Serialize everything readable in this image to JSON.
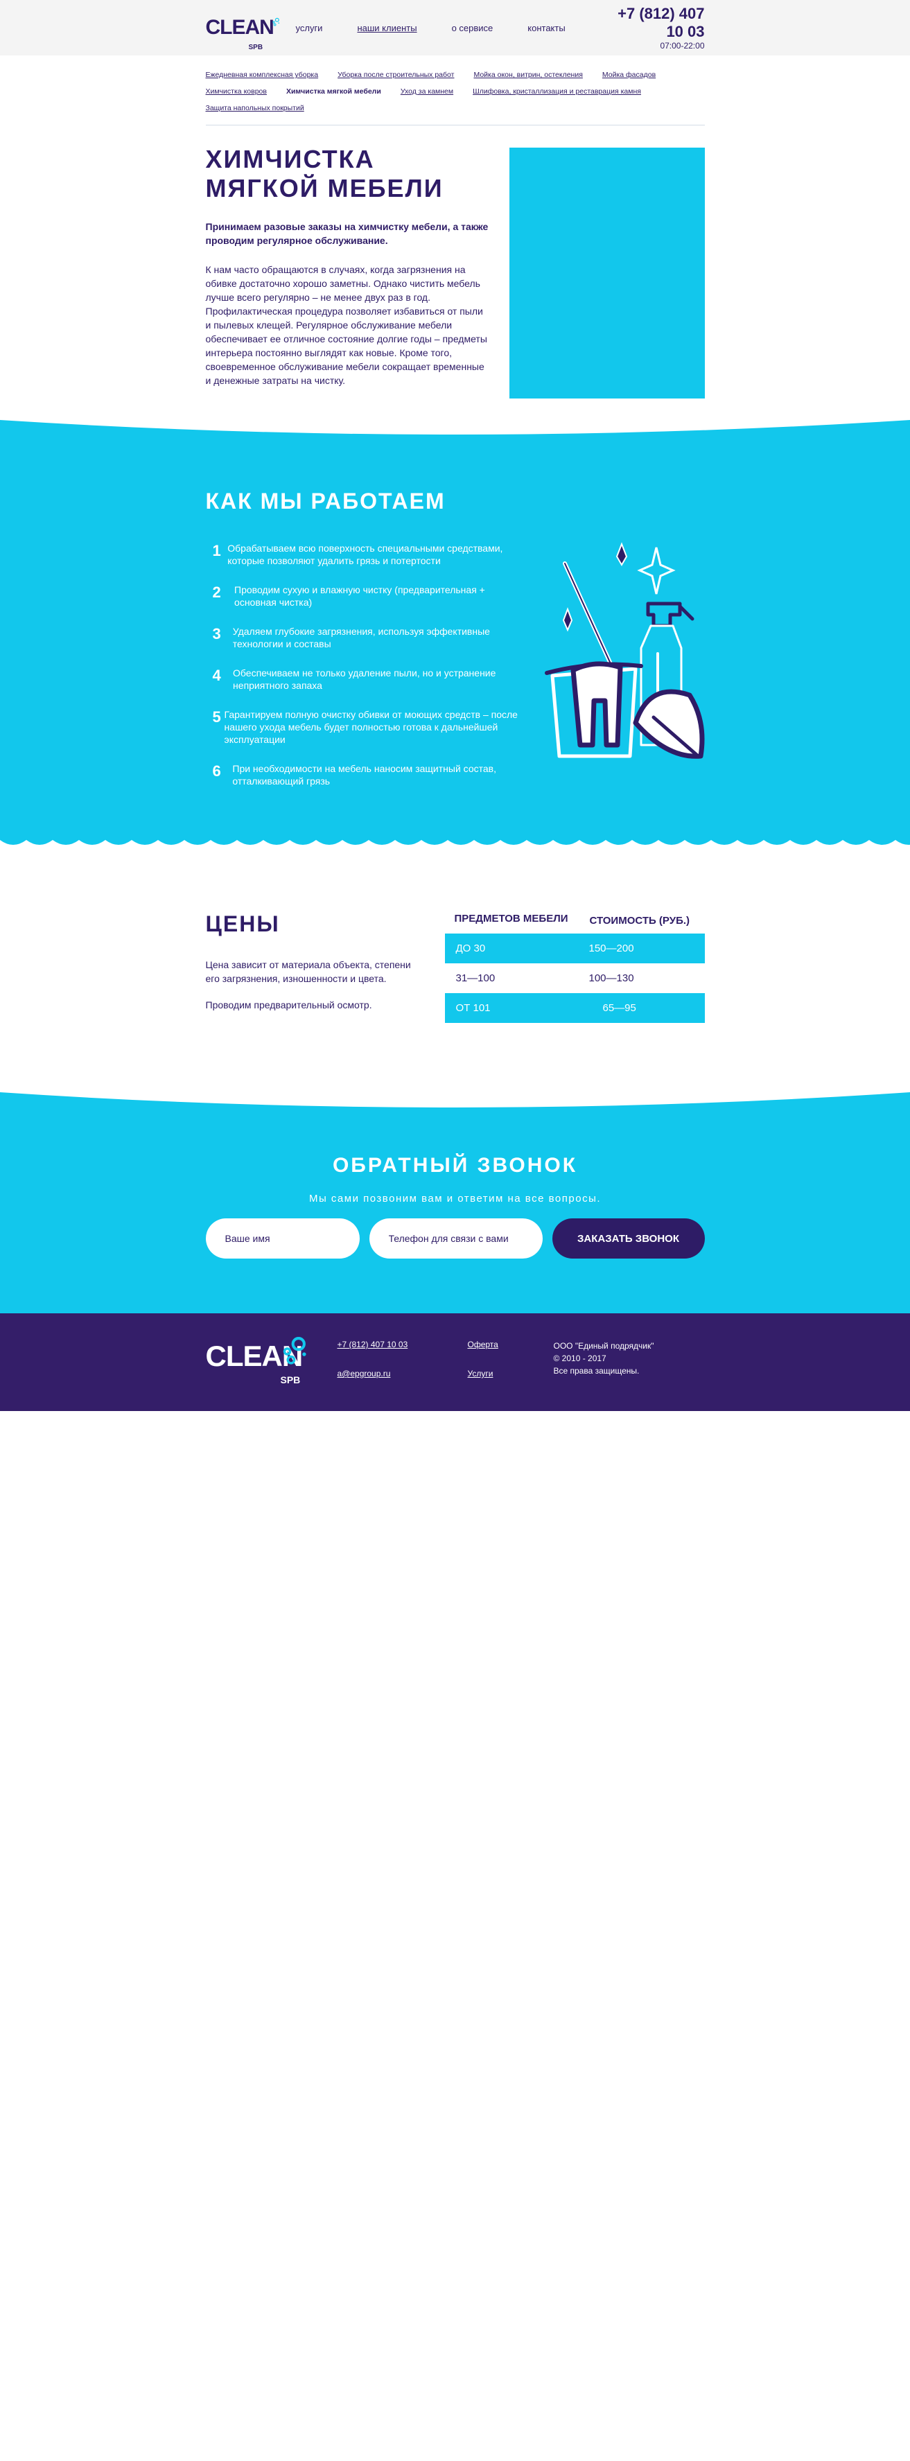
{
  "header": {
    "logo_text": "CLEAN",
    "logo_sub": "SPB",
    "nav": [
      "услуги",
      "наши клиенты",
      "о сервисе",
      "контакты"
    ],
    "phone": "+7 (812) 407 10 03",
    "hours": "07:00-22:00"
  },
  "submenu": {
    "items": [
      "Ежедневная комплексная уборка",
      "Уборка после строительных работ",
      "Мойка окон, витрин, остекления",
      "Мойка фасадов",
      "Химчистка ковров",
      "Химчистка мягкой мебели",
      "Уход за камнем",
      "Шлифовка, кристаллизация и реставрация камня",
      "Защита напольных покрытий"
    ]
  },
  "hero": {
    "title": "Химчистка мягкой мебели",
    "lead": "Принимаем разовые заказы на химчистку мебели, а также проводим регулярное обслуживание.",
    "text": "К нам часто обращаются в случаях, когда загрязнения на обивке достаточно хорошо заметны. Однако чистить мебель лучше всего регулярно – не менее двух раз в год. Профилактическая процедура позволяет избавиться от пыли и пылевых клещей. Регулярное обслуживание мебели обеспечивает ее отличное состояние долгие годы – предметы интерьера постоянно выглядят как новые. Кроме того, своевременное обслуживание мебели сокращает временные и денежные затраты на чистку."
  },
  "how": {
    "title": "КАК МЫ РАБОТАЕМ",
    "steps": [
      {
        "num": "1",
        "text": "Обрабатываем всю поверхность специальными средствами, которые позволяют удалить грязь и потертости"
      },
      {
        "num": "2",
        "text": "Проводим сухую и влажную чистку (предварительная + основная чистка)"
      },
      {
        "num": "3",
        "text": "Удаляем глубокие загрязнения, используя эффективные технологии и составы"
      },
      {
        "num": "4",
        "text": "Обеспечиваем не только удаление пыли, но и устранение неприятного запаха"
      },
      {
        "num": "5",
        "text": "Гарантируем полную очистку обивки от моющих средств – после нашего ухода мебель будет полностью готова к дальнейшей эксплуатации"
      },
      {
        "num": "6",
        "text": "При необходимости на мебель наносим защитный состав, отталкивающий грязь"
      }
    ]
  },
  "prices": {
    "title": "ЦЕНЫ",
    "text": "Цена зависит от материала объекта, степени его загрязнения, изношенности и цвета.",
    "note": "Проводим предварительный осмотр.",
    "col1": "ПРЕДМЕТОВ МЕБЕЛИ",
    "col2": "СТОИМОСТЬ (РУБ.)",
    "rows": [
      {
        "items": "ДО 30",
        "cost": "150—200"
      },
      {
        "items": "31—100",
        "cost": "100—130"
      },
      {
        "items": "ОТ 101",
        "cost": "65—95"
      }
    ]
  },
  "callback": {
    "title": "ОБРАТНЫЙ ЗВОНОК",
    "subtitle": "Мы сами позвоним вам и ответим на все вопросы.",
    "name_placeholder": "Ваше имя",
    "phone_placeholder": "Телефон для связи с вами",
    "button": "ЗАКАЗАТЬ ЗВОНОК"
  },
  "footer": {
    "logo_text": "CLEAN",
    "logo_sub": "SPB",
    "phone": "+7 (812) 407 10 03",
    "email": "a@epgroup.ru",
    "offer": "Оферта",
    "services": "Услуги",
    "company": "ООО \"Единый подрядчик\"",
    "years": "© 2010 - 2017",
    "rights": "Все права защищены."
  },
  "colors": {
    "accent": "#12c7ec",
    "brand": "#2e1c66",
    "footer_bg": "#341e69"
  }
}
